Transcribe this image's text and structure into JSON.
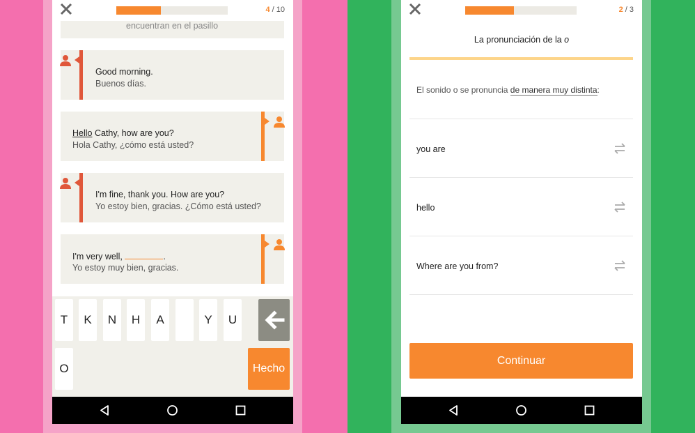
{
  "left_screen": {
    "progress": {
      "current": "4",
      "separator": " / ",
      "total": "10",
      "fraction": 0.4
    },
    "faded_top_text": "encuentran en el pasillo",
    "messages": [
      {
        "speaker": "left",
        "en": "Good morning.",
        "es": "Buenos días."
      },
      {
        "speaker": "right",
        "en_underlined": "Hello",
        "en_rest": " Cathy, how are you?",
        "es": "Hola Cathy, ¿cómo está usted?"
      },
      {
        "speaker": "left",
        "en": "I'm fine, thank you. How are you?",
        "es": "Yo estoy bien, gracias. ¿Cómo está usted?"
      },
      {
        "speaker": "right",
        "en_prefix": "I'm very well, ",
        "en_suffix": ".",
        "es": "Yo estoy muy bien, gracias."
      }
    ],
    "keyboard": {
      "row1": [
        "T",
        "K",
        "N",
        "H",
        "A",
        "",
        "Y",
        "U"
      ],
      "row2": [
        "O"
      ],
      "done_label": "Hecho"
    }
  },
  "right_screen": {
    "progress": {
      "current": "2",
      "separator": " / ",
      "total": "3",
      "fraction": 0.44
    },
    "title": "La pronunciación de la ",
    "title_italic": "o",
    "prompt_prefix": "El sonido o se pronuncia ",
    "prompt_highlight": "de manera muy distinta",
    "prompt_suffix": ":",
    "options": [
      "you are",
      "hello",
      "Where are you from?"
    ],
    "continue_label": "Continuar"
  },
  "colors": {
    "accent": "#f7882f",
    "left_background": "#f46fae",
    "right_background": "#31b35c",
    "speaker_red": "#e0573a",
    "bubble": "#f1f0ea"
  },
  "icons": [
    "close-icon",
    "person-icon",
    "backspace-arrow-icon",
    "swap-arrows-icon",
    "nav-back-icon",
    "nav-home-icon",
    "nav-recents-icon"
  ]
}
